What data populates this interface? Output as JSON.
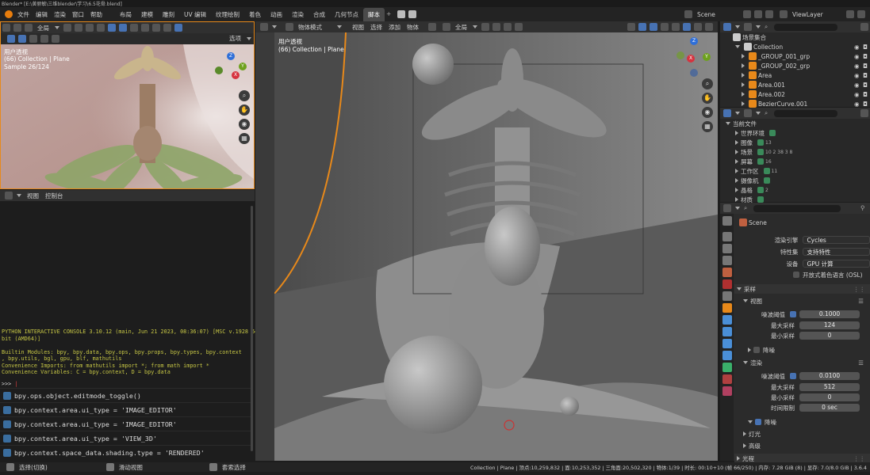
{
  "title": "Blender* [E:\\黄丽敏\\三维blender\\学习\\6.5花骨.blend]",
  "menu": [
    "文件",
    "编辑",
    "渲染",
    "窗口",
    "帮助"
  ],
  "workspaces": [
    "布局",
    "建模",
    "雕刻",
    "UV 编辑",
    "纹理绘制",
    "着色",
    "动画",
    "渲染",
    "合成",
    "几何节点",
    "脚本"
  ],
  "active_workspace": "脚本",
  "scene_name": "Scene",
  "view_layer": "ViewLayer",
  "left_viewport": {
    "header_select": "全局",
    "options": "选项",
    "mode_label": "用户透视",
    "collection": "(66) Collection | Plane",
    "sample": "Sample 26/124"
  },
  "console": {
    "menu": [
      "视图",
      "控制台"
    ],
    "lines": [
      "PYTHON INTERACTIVE CONSOLE 3.10.12 (main, Jun 21 2023, 08:36:07) [MSC v.1928 64",
      "bit (AMD64)]",
      "",
      "Builtin Modules:       bpy, bpy.data, bpy.ops, bpy.props, bpy.types, bpy.context",
      ", bpy.utils, bgl, gpu, blf, mathutils",
      "Convenience Imports:   from mathutils import *; from math import *",
      "Convenience Variables: C = bpy.context, D = bpy.data"
    ],
    "prompt": ">>> ",
    "history": [
      "bpy.ops.object.editmode_toggle()",
      "bpy.context.area.ui_type = 'IMAGE_EDITOR'",
      "bpy.context.area.ui_type = 'IMAGE_EDITOR'",
      "bpy.context.area.ui_type = 'VIEW_3D'",
      "bpy.context.space_data.shading.type = 'RENDERED'"
    ]
  },
  "viewport": {
    "mode": "物体模式",
    "menus": [
      "视图",
      "选择",
      "添加",
      "物体"
    ],
    "transform": "全局",
    "persp": "用户透视",
    "collection": "(66) Collection | Plane"
  },
  "outliner": {
    "root": "场景集合",
    "items": [
      {
        "name": "Collection",
        "indent": 1
      },
      {
        "name": "_GROUP_001_grp",
        "indent": 2
      },
      {
        "name": "_GROUP_002_grp",
        "indent": 2
      },
      {
        "name": "Area",
        "indent": 2
      },
      {
        "name": "Area.001",
        "indent": 2
      },
      {
        "name": "Area.002",
        "indent": 2
      },
      {
        "name": "BezierCurve.001",
        "indent": 2
      }
    ]
  },
  "blend_file": {
    "root": "当前文件",
    "items": [
      {
        "name": "世界环境",
        "badge": ""
      },
      {
        "name": "图像",
        "badge": "13"
      },
      {
        "name": "场景",
        "badge": "10  2  38  3  8"
      },
      {
        "name": "屏幕",
        "badge": "16"
      },
      {
        "name": "工作区",
        "badge": "11"
      },
      {
        "name": "摄像机",
        "badge": ""
      },
      {
        "name": "晶格",
        "badge": "2"
      },
      {
        "name": "材质",
        "badge": ""
      }
    ]
  },
  "properties": {
    "scene": "Scene",
    "engine_label": "渲染引擎",
    "engine": "Cycles",
    "feature_label": "特性集",
    "feature": "支持特性",
    "device_label": "设备",
    "device": "GPU 计算",
    "osl": "开放式着色语言 (OSL)",
    "sampling": "采样",
    "viewport": "视图",
    "noise_threshold_label": "噪波阈值",
    "vp_threshold": "0.1000",
    "max_samples_label": "最大采样",
    "vp_max": "124",
    "min_samples_label": "最小采样",
    "vp_min": "0",
    "denoise": "降噪",
    "render": "渲染",
    "r_threshold": "0.0100",
    "r_max": "512",
    "r_min": "0",
    "time_limit_label": "时间限制",
    "time_limit": "0 sec",
    "lights": "灯光",
    "advanced": "高级",
    "light_paths": "光程"
  },
  "status": {
    "left": "选择(切换)",
    "mid": "滑动视图",
    "mid2": "套索选择",
    "right": "Collection | Plane | 顶点:10,259,832 | 面:10,253,352 | 三角面:20,502,320 | 物体:1/39 | 时长: 00:10+10 (帧 66/250) | 内存: 7.28 GiB (8) | 显存: 7.0/8.0 GiB | 3.6.4"
  }
}
